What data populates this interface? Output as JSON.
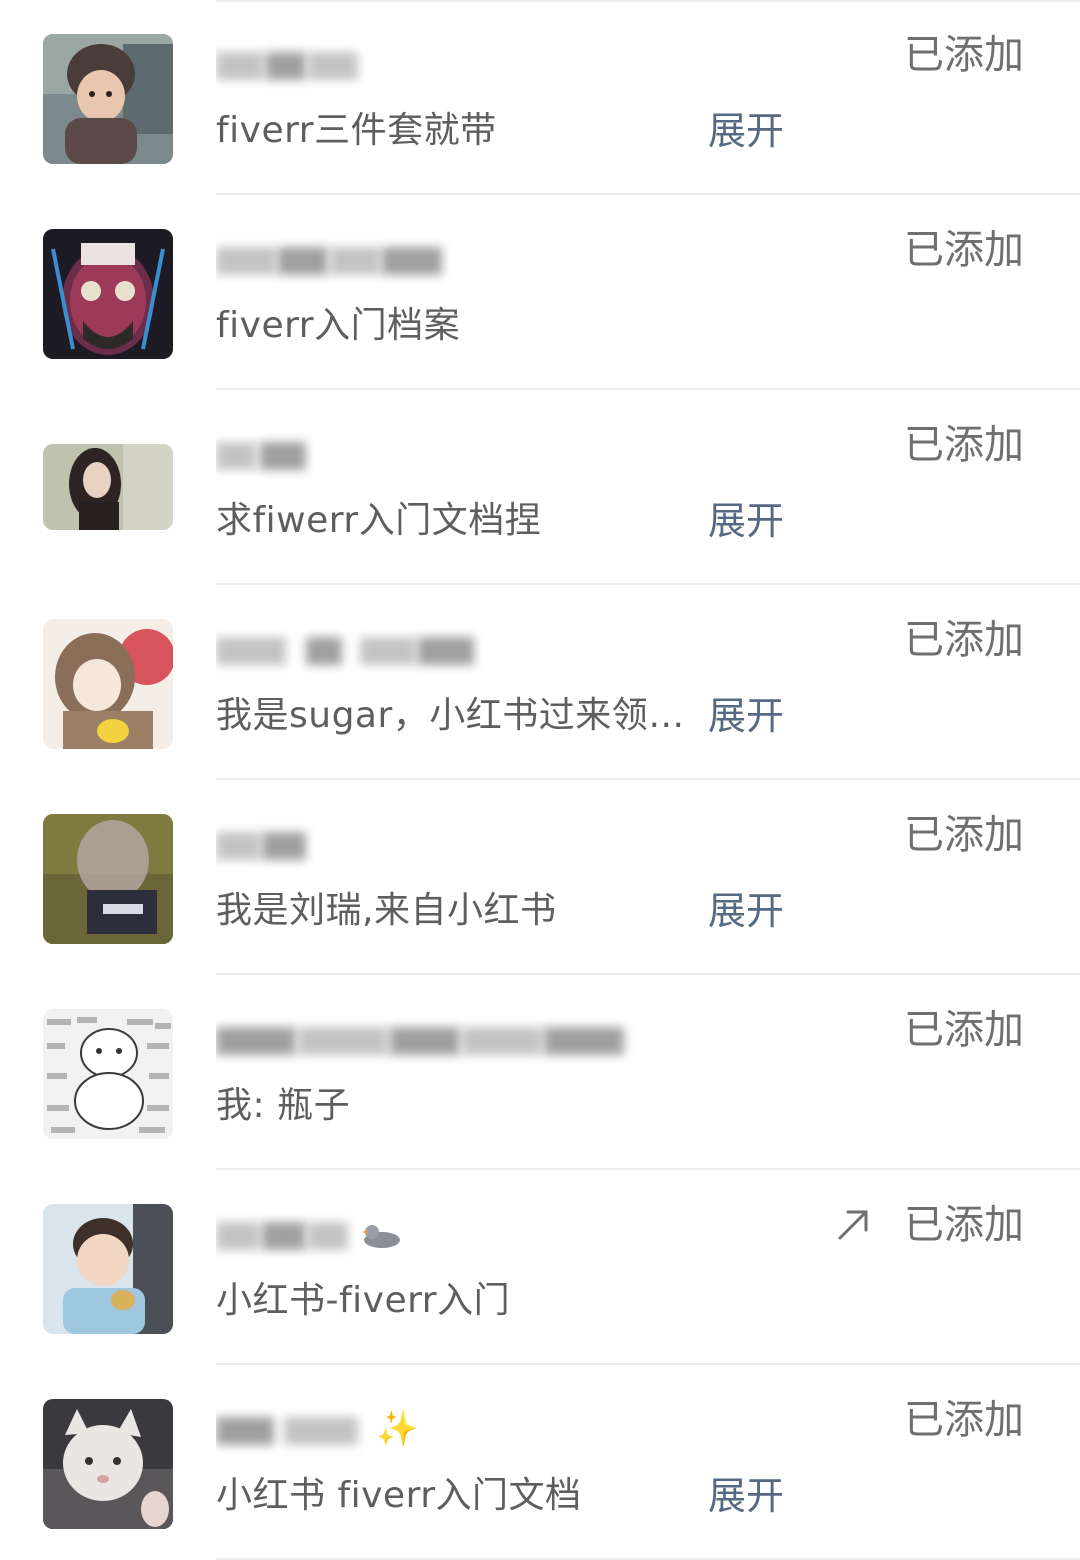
{
  "contacts": [
    {
      "message": "fiverr三件套就带",
      "expand_label": "展开",
      "status": "已添加"
    },
    {
      "message": "fiverr入门档案",
      "status": "已添加"
    },
    {
      "message": "求fiwerr入门文档捏",
      "expand_label": "展开",
      "status": "已添加"
    },
    {
      "message": "我是sugar，小红书过来领…",
      "expand_label": "展开",
      "status": "已添加"
    },
    {
      "message": "我是刘瑞,来自小红书",
      "expand_label": "展开",
      "status": "已添加"
    },
    {
      "message": "我: 瓶子",
      "status": "已添加"
    },
    {
      "message": "小红书-fiverr入门",
      "status": "已添加",
      "arrow_icon": "arrow-up-right-icon"
    },
    {
      "message": "小红书 fiverr入门文档",
      "expand_label": "展开",
      "status": "已添加"
    }
  ],
  "colors": {
    "expand_link": "#556a82",
    "status_text": "#6f6f6f",
    "message_text": "#5e5e5e",
    "divider": "#ececec"
  }
}
